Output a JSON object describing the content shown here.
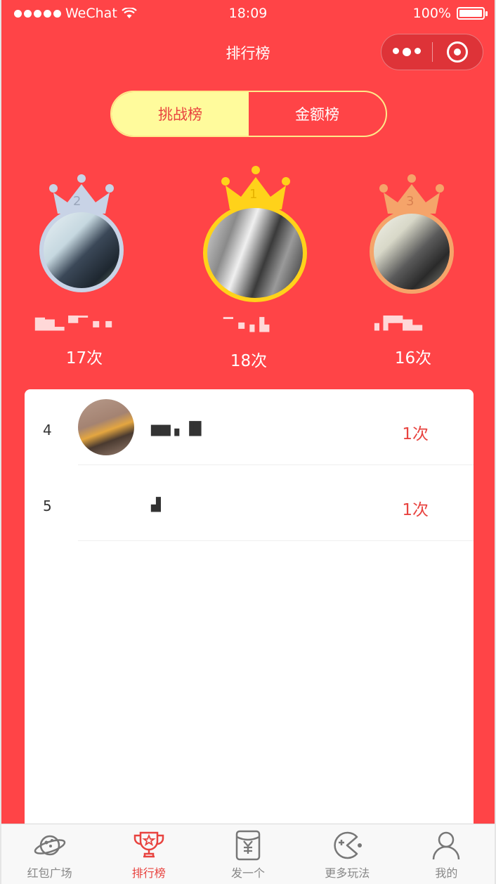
{
  "status_bar": {
    "carrier": "WeChat",
    "time": "18:09",
    "battery": "100%"
  },
  "nav": {
    "title": "排行榜"
  },
  "tabs": [
    {
      "label": "挑战榜",
      "active": true
    },
    {
      "label": "金额榜",
      "active": false
    }
  ],
  "podium": [
    {
      "rank": "2",
      "name": "▇▆▂ ▀▔ ▪ ▪",
      "count": "17次",
      "color": "#c8d3e6"
    },
    {
      "rank": "1",
      "name": "▔ ▪ ▖▙",
      "count": "18次",
      "color": "#ffd21a"
    },
    {
      "rank": "3",
      "name": "▗ ▛▀▆▃",
      "count": "16次",
      "color": "#f5a46a"
    }
  ],
  "list": [
    {
      "rank": "4",
      "name": "▆▆ ▖▐▊",
      "count": "1次"
    },
    {
      "rank": "5",
      "name": "▟",
      "count": "1次"
    }
  ],
  "tabbar": [
    {
      "label": "红包广场",
      "icon": "planet-icon",
      "active": false
    },
    {
      "label": "排行榜",
      "icon": "trophy-icon",
      "active": true
    },
    {
      "label": "发一个",
      "icon": "red-packet-icon",
      "active": false
    },
    {
      "label": "更多玩法",
      "icon": "game-icon",
      "active": false
    },
    {
      "label": "我的",
      "icon": "user-icon",
      "active": false
    }
  ],
  "colors": {
    "background": "#ff4447",
    "accent": "#e8433f",
    "tab_active_bg": "#fffb9c"
  }
}
